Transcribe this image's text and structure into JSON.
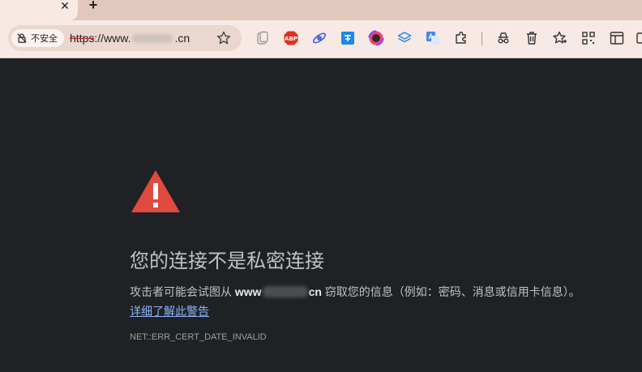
{
  "tabs": {
    "close_glyph": "✕",
    "new_tab_glyph": "+"
  },
  "omnibox": {
    "security_label": "不安全",
    "url_scheme": "https",
    "url_prefix": "://www.",
    "url_suffix": ".cn"
  },
  "toolbar": {
    "icons": [
      "clipboard-icon",
      "adblock-plus-icon",
      "satellite-icon",
      "translate-bubble-icon",
      "color-picker-icon",
      "layers-icon",
      "google-translate-icon",
      "extensions-puzzle-icon",
      "incognito-icon",
      "trash-icon",
      "favorites-icon",
      "qr-grid-icon",
      "split-screen-icon",
      "collections-icon"
    ],
    "abp_text": "ABP"
  },
  "page": {
    "headline": "您的连接不是私密连接",
    "description_prefix": "攻击者可能会试图从 ",
    "domain_prefix": "www",
    "domain_suffix": "cn",
    "description_suffix": " 窃取您的信息（例如：密码、消息或信用卡信息）。",
    "details_link": "详细了解此警告",
    "error_code": "NET::ERR_CERT_DATE_INVALID"
  },
  "colors": {
    "page_bg": "#202124",
    "warning_red": "#e04a3f",
    "link_blue": "#8ab4f8",
    "tabstrip": "#e2c7bd",
    "toolbar": "#f7e9e4"
  }
}
